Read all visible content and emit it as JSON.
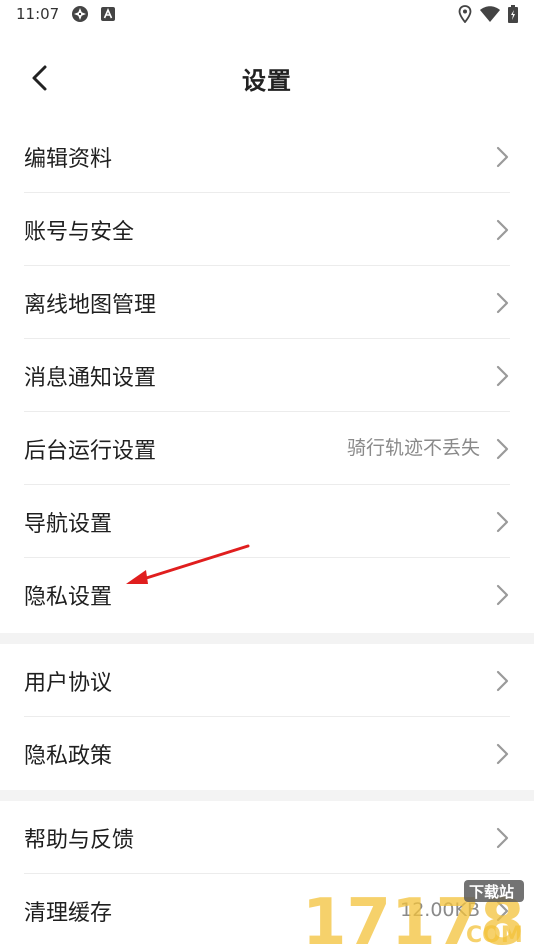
{
  "status_bar": {
    "time": "11:07",
    "icons_left": [
      "sync-icon",
      "a-badge-icon"
    ],
    "icons_right": [
      "location-icon",
      "wifi-icon",
      "battery-icon"
    ]
  },
  "header": {
    "title": "设置",
    "back_icon": "chevron-left-icon"
  },
  "groups": [
    {
      "items": [
        {
          "label": "编辑资料",
          "extra": ""
        },
        {
          "label": "账号与安全",
          "extra": ""
        },
        {
          "label": "离线地图管理",
          "extra": ""
        },
        {
          "label": "消息通知设置",
          "extra": ""
        },
        {
          "label": "后台运行设置",
          "extra": "骑行轨迹不丢失"
        },
        {
          "label": "导航设置",
          "extra": ""
        },
        {
          "label": "隐私设置",
          "extra": ""
        }
      ]
    },
    {
      "items": [
        {
          "label": "用户协议",
          "extra": ""
        },
        {
          "label": "隐私政策",
          "extra": ""
        }
      ]
    },
    {
      "items": [
        {
          "label": "帮助与反馈",
          "extra": ""
        },
        {
          "label": "清理缓存",
          "extra": "12.00KB"
        }
      ]
    }
  ],
  "annotation": {
    "icon": "red-arrow-icon",
    "color": "#e01e1e"
  },
  "watermark": {
    "text": "17178",
    "sub": "下载站",
    "domain": "COM"
  },
  "colors": {
    "background": "#ffffff",
    "divider": "#ececec",
    "section_gap": "#f3f3f3",
    "secondary_text": "#8a8a8a"
  }
}
